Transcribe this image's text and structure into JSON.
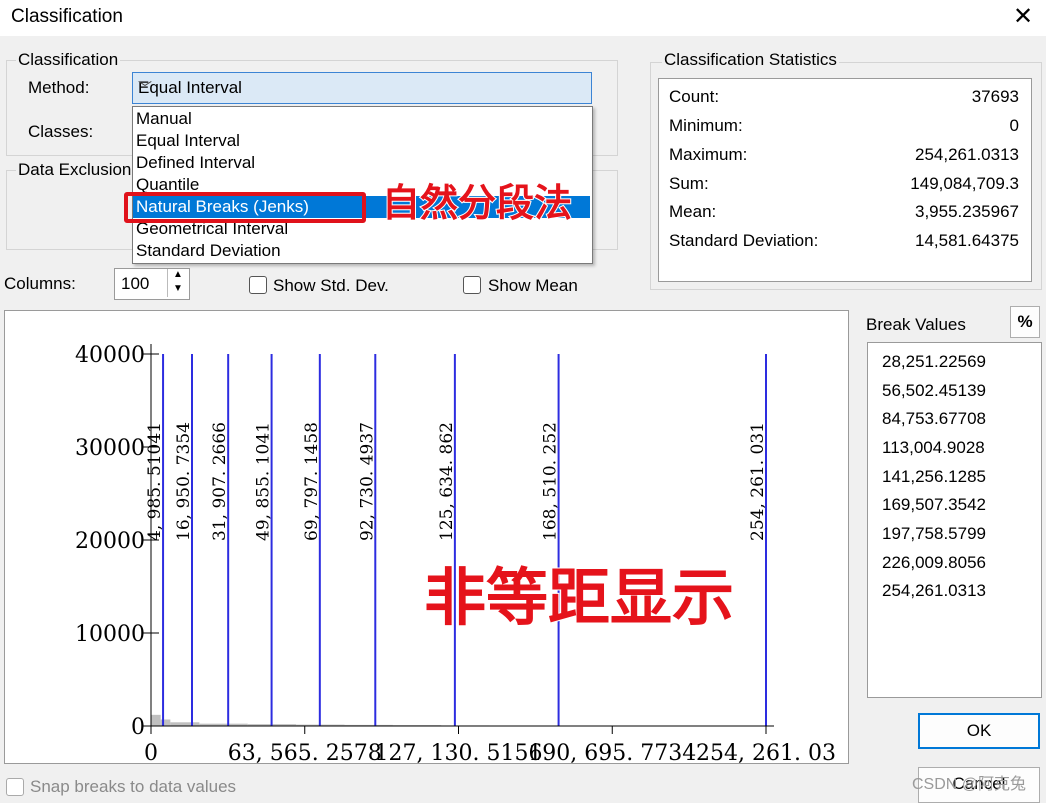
{
  "window": {
    "title": "Classification"
  },
  "classification": {
    "group_label": "Classification",
    "method_label": "Method:",
    "method_value": "Equal Interval",
    "classes_label": "Classes:",
    "dropdown_options": [
      "Manual",
      "Equal Interval",
      "Defined Interval",
      "Quantile",
      "Natural Breaks (Jenks)",
      "Geometrical Interval",
      "Standard Deviation"
    ],
    "highlighted_option": "Natural Breaks (Jenks)"
  },
  "data_exclusion": {
    "label": "Data Exclusion"
  },
  "annotations": {
    "natural_breaks": "自然分段法",
    "unequal_display": "非等距显示"
  },
  "stats": {
    "group_label": "Classification Statistics",
    "rows": [
      {
        "key": "Count:",
        "value": "37693"
      },
      {
        "key": "Minimum:",
        "value": "0"
      },
      {
        "key": "Maximum:",
        "value": "254,261.0313"
      },
      {
        "key": "Sum:",
        "value": "149,084,709.3"
      },
      {
        "key": "Mean:",
        "value": "3,955.235967"
      },
      {
        "key": "Standard Deviation:",
        "value": "14,581.64375"
      }
    ]
  },
  "columns": {
    "label": "Columns:",
    "value": "100"
  },
  "options": {
    "show_std_dev": "Show Std. Dev.",
    "show_mean": "Show Mean",
    "snap": "Snap breaks to data values"
  },
  "break_values": {
    "label": "Break Values",
    "percent_button": "%",
    "values": [
      "28,251.22569",
      "56,502.45139",
      "84,753.67708",
      "113,004.9028",
      "141,256.1285",
      "169,507.3542",
      "197,758.5799",
      "226,009.8056",
      "254,261.0313"
    ]
  },
  "buttons": {
    "ok": "OK",
    "cancel": "Cancel"
  },
  "watermark": "CSDN @阿克兔",
  "chart_data": {
    "type": "bar",
    "title": "",
    "xlabel": "",
    "ylabel": "",
    "ylim": [
      0,
      40000
    ],
    "xlim": [
      0,
      254261.03
    ],
    "y_ticks": [
      0,
      10000,
      20000,
      30000,
      40000
    ],
    "x_tick_labels": [
      "0",
      "63, 565. 2578",
      "127, 130. 5156",
      "190, 695. 7734",
      "254, 261. 03"
    ],
    "break_lines": [
      {
        "x": 4985.51041,
        "label": "4, 985. 51041"
      },
      {
        "x": 16950.7354,
        "label": "16, 950. 7354"
      },
      {
        "x": 31907.2666,
        "label": "31, 907. 2666"
      },
      {
        "x": 49855.1041,
        "label": "49, 855. 1041"
      },
      {
        "x": 69797.1458,
        "label": "69, 797. 1458"
      },
      {
        "x": 92730.4937,
        "label": "92, 730. 4937"
      },
      {
        "x": 125634.862,
        "label": "125, 634. 862"
      },
      {
        "x": 168510.252,
        "label": "168, 510. 252"
      },
      {
        "x": 254261.031,
        "label": "254, 261. 031"
      }
    ],
    "histogram": {
      "x": [
        0,
        4000,
        8000,
        20000,
        40000,
        60000,
        80000,
        100000,
        120000
      ],
      "y": [
        1200,
        700,
        400,
        250,
        200,
        150,
        120,
        90,
        60
      ]
    },
    "colors": {
      "break_line": "#2d2de0",
      "axis": "#000000",
      "histogram": "#c0c0c0"
    }
  }
}
